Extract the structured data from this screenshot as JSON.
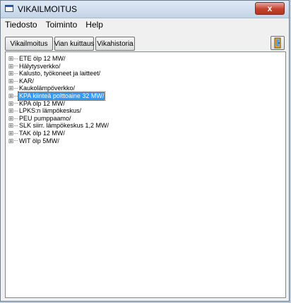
{
  "window": {
    "title": "VIKAILMOITUS",
    "close_label": "x"
  },
  "menu": [
    "Tiedosto",
    "Toiminto",
    "Help"
  ],
  "toolbar": {
    "vikailmoitus": "Vikailmoitus",
    "vian_kuittaus": "Vian kuittaus",
    "vikahistoria": "Vikahistoria"
  },
  "tree": {
    "expander": "⊞",
    "items": [
      "ETE ölp 12 MW/",
      "Hälytysverkko/",
      "Kalusto, työkoneet ja laitteet/",
      "KAR/",
      "Kaukolämpöverkko/",
      "KPA kiinteä polttoaine 32 MW/",
      "KPA ölp 12 MW/",
      "LPKS:n lämpökeskus/",
      "PEU pumppaamo/",
      "SLK siirr. lämpökeskus  1,2 MW/",
      "TAK ölp 12 MW/",
      "WIT ölp  5MW/"
    ],
    "selected_index": 5
  }
}
